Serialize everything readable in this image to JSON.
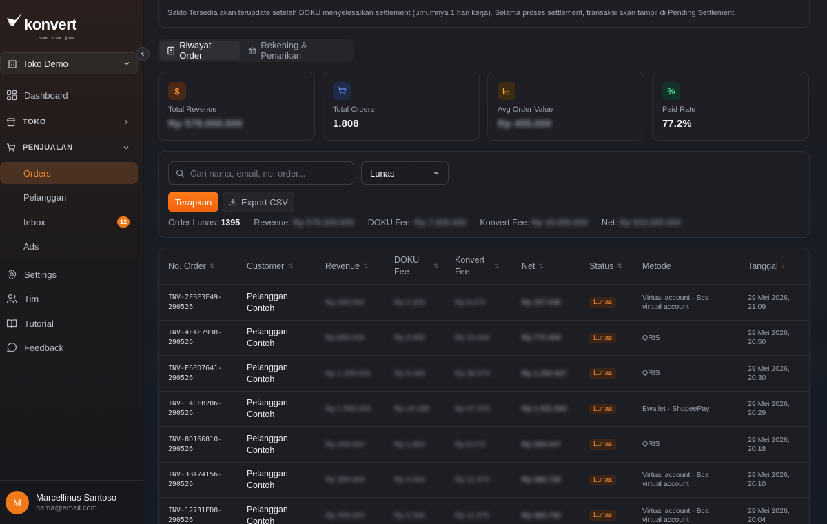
{
  "brand": {
    "name": "konvert",
    "tagline": "build . scale . grow"
  },
  "store": {
    "name": "Toko Demo"
  },
  "nav": {
    "dashboard": "Dashboard",
    "toko": "TOKO",
    "penjualan": "PENJUALAN",
    "orders": "Orders",
    "pelanggan": "Pelanggan",
    "inbox": "Inbox",
    "inbox_count": "12",
    "ads": "Ads",
    "settings": "Settings",
    "tim": "Tim",
    "tutorial": "Tutorial",
    "feedback": "Feedback"
  },
  "user": {
    "initial": "M",
    "name": "Marcellinus Santoso",
    "email": "nama@email.com"
  },
  "notice": "Saldo Tersedia akan terupdate setelah DOKU menyelesaikan settlement (umumnya 1 hari kerja). Selama proses settlement, transaksi akan tampil di Pending Settlement.",
  "tabs": [
    "Riwayat Order",
    "Rekening & Penarikan"
  ],
  "stats": [
    {
      "label": "Total Revenue",
      "value": "Rp 578.000.000",
      "icon": "$",
      "blurred": true
    },
    {
      "label": "Total Orders",
      "value": "1.808",
      "icon": "cart",
      "blurred": false
    },
    {
      "label": "Avg Order Value",
      "value": "Rp 455.000",
      "icon": "bar-chart",
      "blurred": true
    },
    {
      "label": "Paid Rate",
      "value": "77.2%",
      "icon": "%",
      "blurred": false
    }
  ],
  "filters": {
    "search_placeholder": "Cari nama, email, no. order...",
    "status": "Lunas",
    "apply": "Terapkan",
    "export": "Export CSV"
  },
  "summary": {
    "order_label": "Order Lunas:",
    "order_count": "1395",
    "revenue_label": "Revenue:",
    "revenue_value": "Rp 578.000.000",
    "doku_label": "DOKU Fee:",
    "doku_value": "Rp 7.000.000",
    "konvert_label": "Konvert Fee:",
    "konvert_value": "Rp 18.000.000",
    "net_label": "Net:",
    "net_value": "Rp 553.000.000"
  },
  "table": {
    "headers": [
      "No. Order",
      "Customer",
      "Revenue",
      "DOKU Fee",
      "Konvert Fee",
      "Net",
      "Status",
      "Metode",
      "Tanggal"
    ],
    "rows": [
      {
        "order": [
          "INV-2FBE3F49-",
          "290526"
        ],
        "customer": [
          "Pelanggan",
          "Contoh"
        ],
        "revenue": "Rp 269.000",
        "doku": "Rp 3.300",
        "konvert": "Rp 8.070",
        "net": "Rp 257.630",
        "status": "Lunas",
        "method": [
          "Virtual account · Bca",
          "virtual account"
        ],
        "date": [
          "29 Mei 2026,",
          "21.09"
        ]
      },
      {
        "order": [
          "INV-4F4F7938-",
          "290526"
        ],
        "customer": [
          "Pelanggan",
          "Contoh"
        ],
        "revenue": "Rp 800.000",
        "doku": "Rp 5.600",
        "konvert": "Rp 24.000",
        "net": "Rp 770.400",
        "status": "Lunas",
        "method": [
          "QRIS",
          ""
        ],
        "date": [
          "29 Mei 2026,",
          "20.50"
        ]
      },
      {
        "order": [
          "INV-E6ED7641-",
          "290526"
        ],
        "customer": [
          "Pelanggan",
          "Contoh"
        ],
        "revenue": "Rp 1.299.000",
        "doku": "Rp 9.093",
        "konvert": "Rp 38.970",
        "net": "Rp 1.250.937",
        "status": "Lunas",
        "method": [
          "QRIS",
          ""
        ],
        "date": [
          "29 Mei 2026,",
          "20.30"
        ]
      },
      {
        "order": [
          "INV-14CFB206-",
          "290526"
        ],
        "customer": [
          "Pelanggan",
          "Contoh"
        ],
        "revenue": "Rp 1.599.000",
        "doku": "Rp 19.188",
        "konvert": "Rp 47.970",
        "net": "Rp 1.531.842",
        "status": "Lunas",
        "method": [
          "Ewallet · ShopeePay",
          ""
        ],
        "date": [
          "29 Mei 2026,",
          "20.29"
        ]
      },
      {
        "order": [
          "INV-8D166810-",
          "290526"
        ],
        "customer": [
          "Pelanggan",
          "Contoh"
        ],
        "revenue": "Rp 269.000",
        "doku": "Rp 1.883",
        "konvert": "Rp 8.070",
        "net": "Rp 259.047",
        "status": "Lunas",
        "method": [
          "QRIS",
          ""
        ],
        "date": [
          "29 Mei 2026,",
          "20.18"
        ]
      },
      {
        "order": [
          "INV-3B474156-",
          "290526"
        ],
        "customer": [
          "Pelanggan",
          "Contoh"
        ],
        "revenue": "Rp 399.000",
        "doku": "Rp 3.300",
        "konvert": "Rp 11.970",
        "net": "Rp 383.730",
        "status": "Lunas",
        "method": [
          "Virtual account · Bca",
          "virtual account"
        ],
        "date": [
          "29 Mei 2026,",
          "20.10"
        ]
      },
      {
        "order": [
          "INV-12731ED8-",
          "290526"
        ],
        "customer": [
          "Pelanggan",
          "Contoh"
        ],
        "revenue": "Rp 399.000",
        "doku": "Rp 3.300",
        "konvert": "Rp 11.970",
        "net": "Rp 383.730",
        "status": "Lunas",
        "method": [
          "Virtual account · Bca",
          "virtual account"
        ],
        "date": [
          "29 Mei 2026,",
          "20.04"
        ]
      }
    ]
  },
  "colors": {
    "accent": "#f07a18",
    "active_bg": "#4a3122",
    "status_text": "#f39238"
  }
}
